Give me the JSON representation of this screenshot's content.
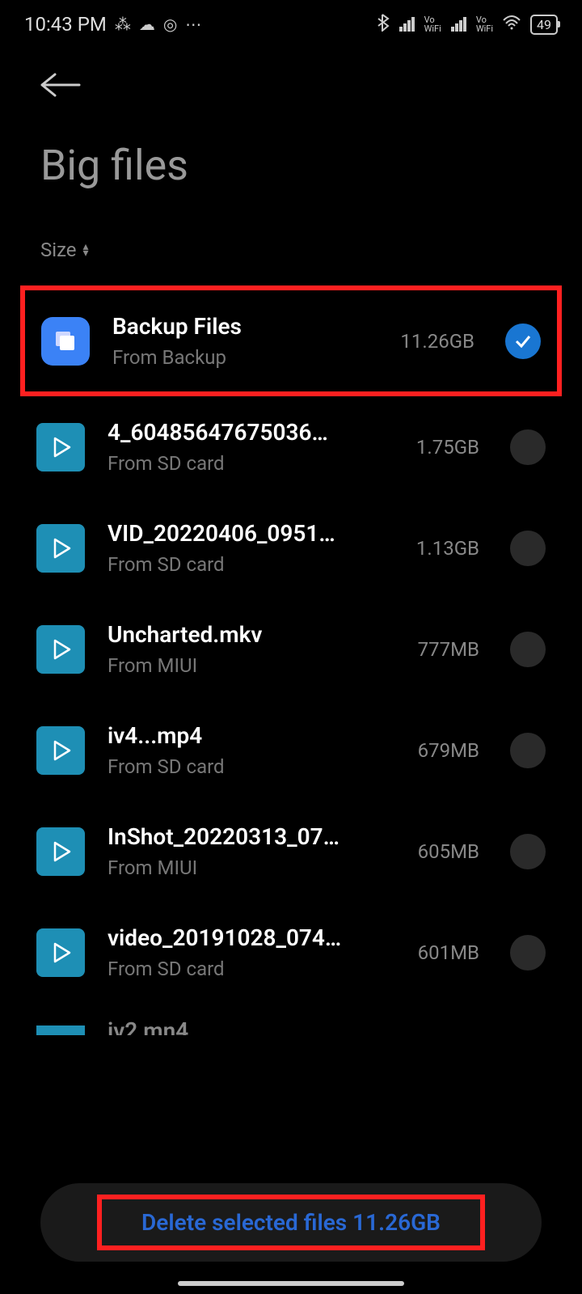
{
  "status_bar": {
    "time": "10:43 PM",
    "battery": "49"
  },
  "page_title": "Big files",
  "sort": {
    "label": "Size"
  },
  "files": [
    {
      "name": "Backup Files",
      "source": "From Backup",
      "size": "11.26GB",
      "icon_type": "backup",
      "checked": true,
      "highlighted": true
    },
    {
      "name": "4_60485647675036…",
      "source": "From SD card",
      "size": "1.75GB",
      "icon_type": "video",
      "checked": false,
      "highlighted": false
    },
    {
      "name": "VID_20220406_0951…",
      "source": "From SD card",
      "size": "1.13GB",
      "icon_type": "video",
      "checked": false,
      "highlighted": false
    },
    {
      "name": "Uncharted.mkv",
      "source": "From MIUI",
      "size": "777MB",
      "icon_type": "video",
      "checked": false,
      "highlighted": false
    },
    {
      "name": "iv4...mp4",
      "source": "From SD card",
      "size": "679MB",
      "icon_type": "video",
      "checked": false,
      "highlighted": false
    },
    {
      "name": "InShot_20220313_07…",
      "source": "From MIUI",
      "size": "605MB",
      "icon_type": "video",
      "checked": false,
      "highlighted": false
    },
    {
      "name": "video_20191028_074…",
      "source": "From SD card",
      "size": "601MB",
      "icon_type": "video",
      "checked": false,
      "highlighted": false
    }
  ],
  "partial_file": {
    "name": "iv2 mn4"
  },
  "delete_button": {
    "label": "Delete selected files 11.26GB"
  }
}
